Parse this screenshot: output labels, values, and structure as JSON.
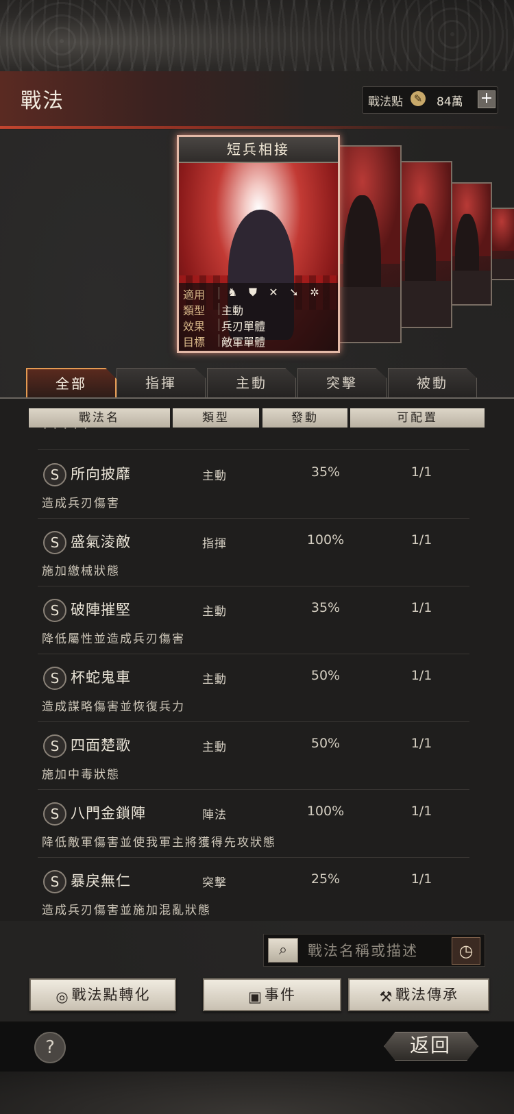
{
  "header": {
    "title": "戰法",
    "points_label": "戰法點",
    "points_icon": "ink-brush-coin-icon",
    "points_value": "84萬",
    "add_label": "+"
  },
  "featured_card": {
    "name": "短兵相接",
    "applicable_label": "適用",
    "applicable_units": [
      "cavalry-icon",
      "shield-icon",
      "bow-icon",
      "spear-icon",
      "siege-wheel-icon"
    ],
    "type_label": "類型",
    "type_value": "主動",
    "effect_label": "效果",
    "effect_value": "兵刃單體",
    "target_label": "目標",
    "target_value": "敵軍單體"
  },
  "tabs": [
    {
      "label": "全部",
      "active": true
    },
    {
      "label": "指揮",
      "active": false
    },
    {
      "label": "主動",
      "active": false
    },
    {
      "label": "突擊",
      "active": false
    },
    {
      "label": "被動",
      "active": false
    }
  ],
  "columns": [
    "戰法名",
    "類型",
    "發動",
    "可配置"
  ],
  "rows": [
    {
      "grade": "S",
      "name": "所向披靡",
      "type": "主動",
      "rate": "35%",
      "slots": "1/1",
      "desc": "造成兵刃傷害"
    },
    {
      "grade": "S",
      "name": "盛氣淩敵",
      "type": "指揮",
      "rate": "100%",
      "slots": "1/1",
      "desc": "施加繳械狀態"
    },
    {
      "grade": "S",
      "name": "破陣摧堅",
      "type": "主動",
      "rate": "35%",
      "slots": "1/1",
      "desc": "降低屬性並造成兵刃傷害"
    },
    {
      "grade": "S",
      "name": "杯蛇鬼車",
      "type": "主動",
      "rate": "50%",
      "slots": "1/1",
      "desc": "造成謀略傷害並恢復兵力"
    },
    {
      "grade": "S",
      "name": "四面楚歌",
      "type": "主動",
      "rate": "50%",
      "slots": "1/1",
      "desc": "施加中毒狀態"
    },
    {
      "grade": "S",
      "name": "八門金鎖陣",
      "type": "陣法",
      "rate": "100%",
      "slots": "1/1",
      "desc": "降低敵軍傷害並使我軍主將獲得先攻狀態"
    },
    {
      "grade": "S",
      "name": "暴戾無仁",
      "type": "突擊",
      "rate": "25%",
      "slots": "1/1",
      "desc": "造成兵刃傷害並施加混亂狀態"
    }
  ],
  "search": {
    "placeholder": "戰法名稱或描述"
  },
  "buttons": {
    "convert": "戰法點轉化",
    "events": "事件",
    "inherit": "戰法傳承"
  },
  "footer": {
    "help": "?",
    "back": "返回"
  }
}
